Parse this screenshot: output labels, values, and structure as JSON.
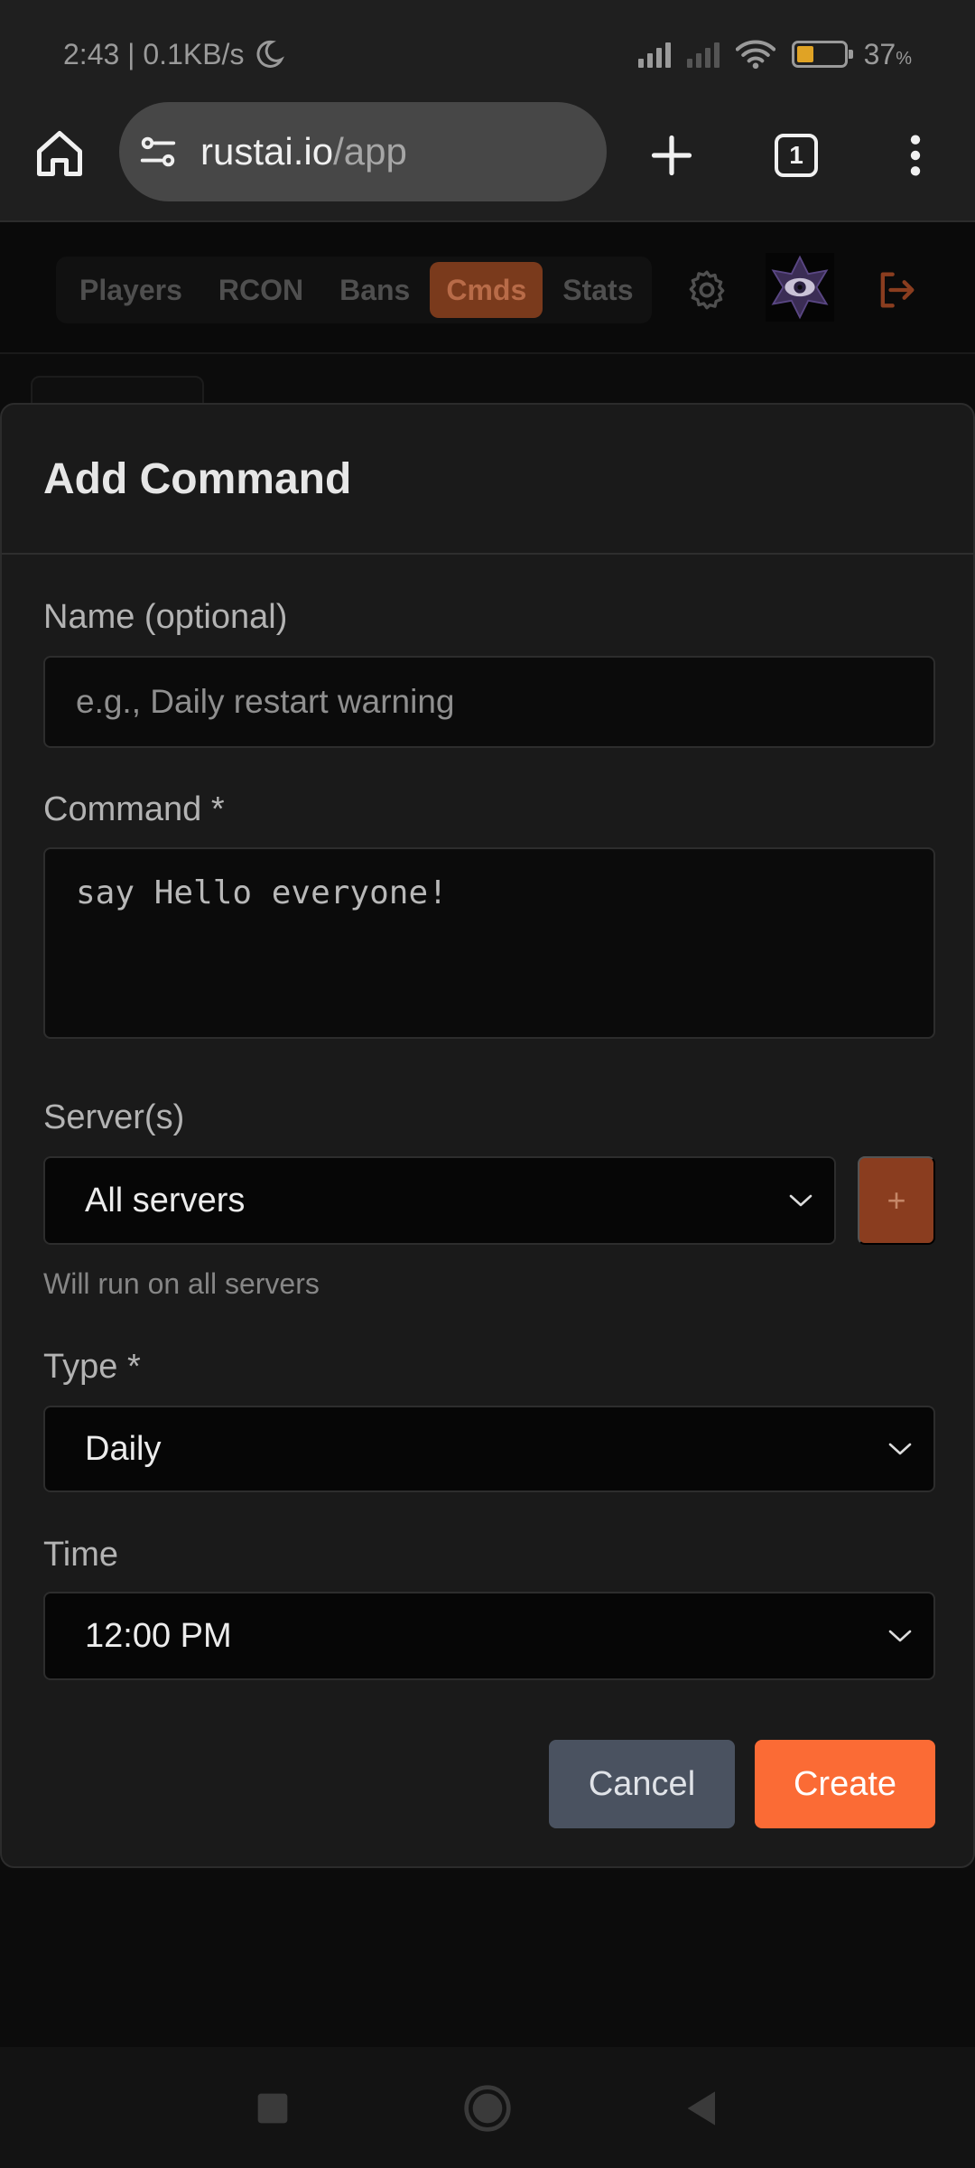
{
  "status_bar": {
    "time_speed": "2:43 | 0.1KB/s",
    "battery": "37",
    "battery_unit": "%",
    "battery_level": 0.37
  },
  "browser": {
    "url_domain": "rustai.io",
    "url_path": "/app",
    "tab_count": "1",
    "icons": [
      "home-icon",
      "site-settings-icon",
      "new-tab-icon",
      "tab-switcher-icon",
      "more-vert-icon"
    ]
  },
  "app_nav": {
    "tabs": [
      {
        "label": "Players",
        "active": false
      },
      {
        "label": "RCON",
        "active": false
      },
      {
        "label": "Bans",
        "active": false
      },
      {
        "label": "Cmds",
        "active": true
      },
      {
        "label": "Stats",
        "active": false
      }
    ],
    "icons": [
      "gear-icon",
      "avatar-eye-icon",
      "logout-icon"
    ],
    "accent": "#fb6b35"
  },
  "modal": {
    "title": "Add Command",
    "name_label": "Name (optional)",
    "name_placeholder": "e.g., Daily restart warning",
    "command_label": "Command *",
    "command_value": "say Hello everyone!",
    "servers_label": "Server(s)",
    "servers_selected": "All servers",
    "servers_add": "+",
    "servers_helper": "Will run on all servers",
    "type_label": "Type *",
    "type_selected": "Daily",
    "time_label": "Time",
    "time_selected": "12:00 PM",
    "cancel_label": "Cancel",
    "create_label": "Create"
  },
  "system_nav": {
    "icons": [
      "recents-square-icon",
      "home-circle-icon",
      "back-triangle-icon"
    ]
  }
}
